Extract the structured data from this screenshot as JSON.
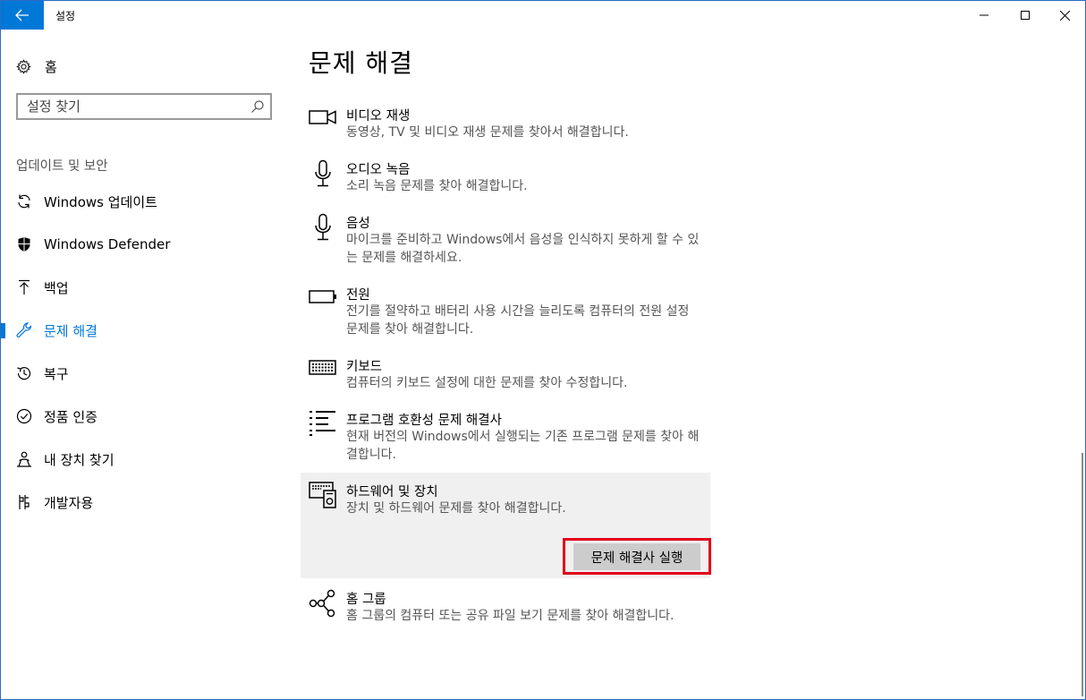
{
  "window": {
    "title": "설정"
  },
  "sidebar": {
    "home_label": "홈",
    "search_placeholder": "설정 찾기",
    "section_label": "업데이트 및 보안",
    "items": [
      {
        "label": "Windows 업데이트",
        "icon": "refresh-icon"
      },
      {
        "label": "Windows Defender",
        "icon": "shield-icon"
      },
      {
        "label": "백업",
        "icon": "backup-arrow-icon"
      },
      {
        "label": "문제 해결",
        "icon": "wrench-icon",
        "active": true
      },
      {
        "label": "복구",
        "icon": "history-icon"
      },
      {
        "label": "정품 인증",
        "icon": "check-circle-icon"
      },
      {
        "label": "내 장치 찾기",
        "icon": "person-icon"
      },
      {
        "label": "개발자용",
        "icon": "developer-icon"
      }
    ]
  },
  "main": {
    "title": "문제 해결",
    "items": [
      {
        "title": "비디오 재생",
        "desc": "동영상, TV 및 비디오 재생 문제를 찾아서 해결합니다.",
        "icon": "video-camera-icon"
      },
      {
        "title": "오디오 녹음",
        "desc": "소리 녹음 문제를 찾아 해결합니다.",
        "icon": "microphone-icon"
      },
      {
        "title": "음성",
        "desc": "마이크를 준비하고 Windows에서 음성을 인식하지 못하게 할 수 있는 문제를 해결하세요.",
        "icon": "microphone-icon"
      },
      {
        "title": "전원",
        "desc": "전기를 절약하고 배터리 사용 시간을 늘리도록 컴퓨터의 전원 설정 문제를 찾아 해결합니다.",
        "icon": "battery-icon"
      },
      {
        "title": "키보드",
        "desc": "컴퓨터의 키보드 설정에 대한 문제를 찾아 수정합니다.",
        "icon": "keyboard-icon"
      },
      {
        "title": "프로그램 호환성 문제 해결사",
        "desc": "현재 버전의 Windows에서 실행되는 기존 프로그램 문제를 찾아 해결합니다.",
        "icon": "list-icon"
      },
      {
        "title": "하드웨어 및 장치",
        "desc": "장치 및 하드웨어 문제를 찾아 해결합니다.",
        "icon": "hardware-icon",
        "selected": true
      },
      {
        "title": "홈 그룹",
        "desc": "홈 그룹의 컴퓨터 또는 공유 파일 보기 문제를 찾아 해결합니다.",
        "icon": "homegroup-icon"
      }
    ],
    "run_button": "문제 해결사 실행"
  },
  "colors": {
    "accent": "#0078d7",
    "highlight_outline": "#e2001a",
    "selected_bg": "#f0f0f0"
  }
}
